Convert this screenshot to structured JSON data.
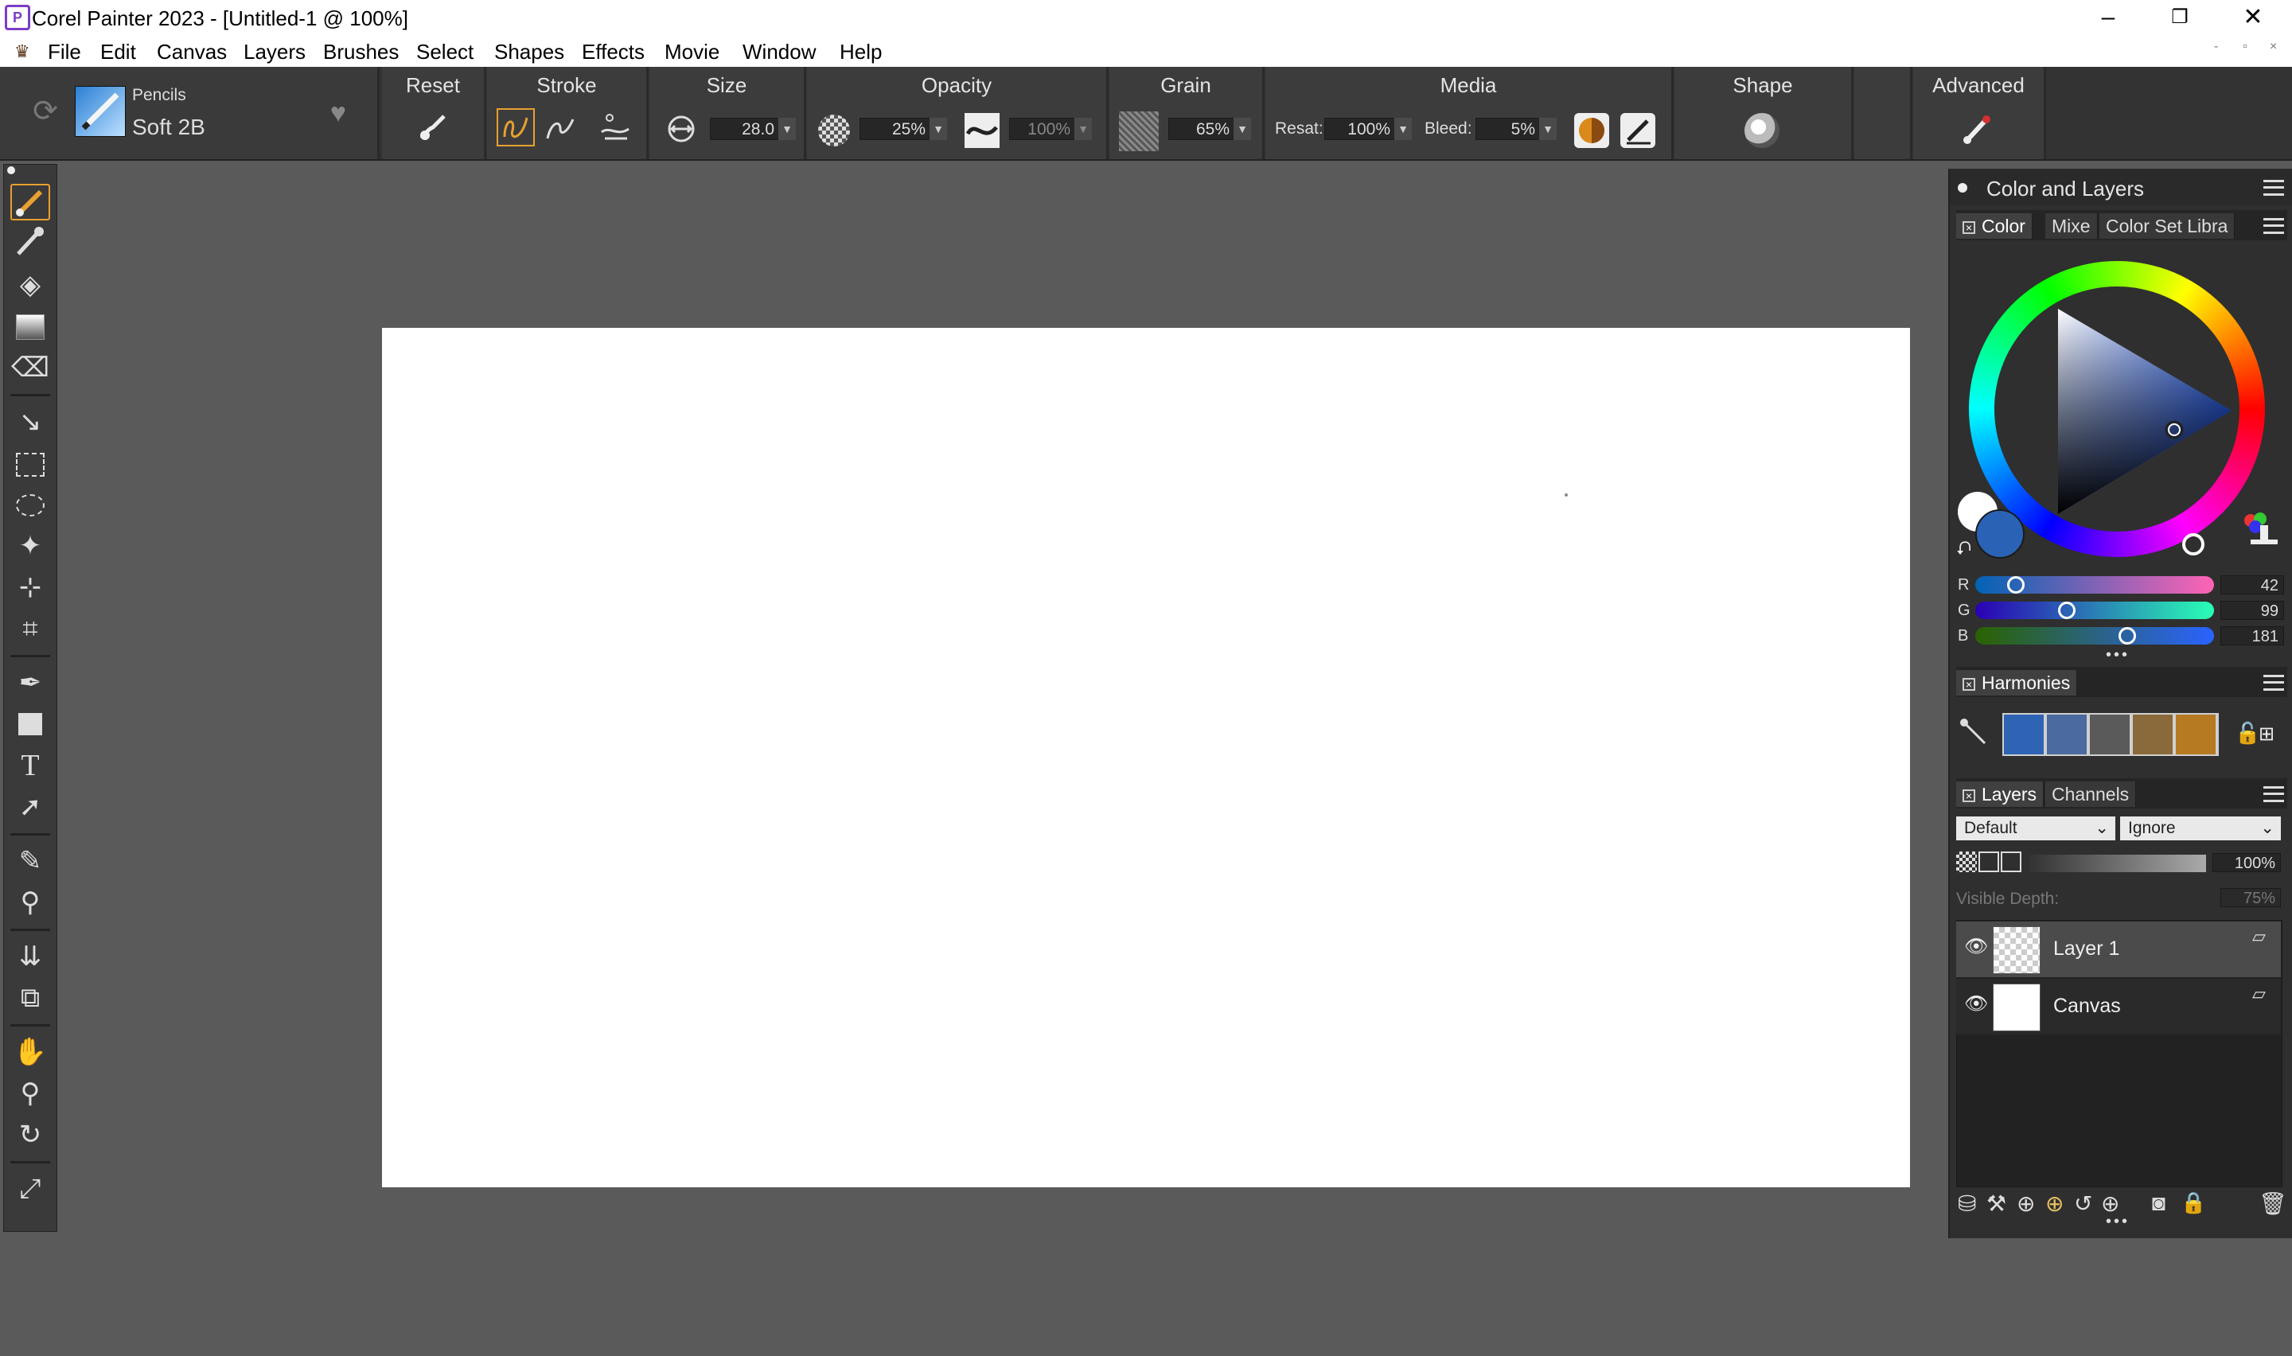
{
  "window": {
    "title": "Corel Painter 2023 - [Untitled-1 @ 100%]",
    "app_icon": "P",
    "controls": {
      "minimize": "–",
      "restore": "❐",
      "close": "✕"
    },
    "mdi_controls": [
      "-",
      "▫",
      "×"
    ]
  },
  "menu": [
    "File",
    "Edit",
    "Canvas",
    "Layers",
    "Brushes",
    "Select",
    "Shapes",
    "Effects",
    "Movie",
    "Window",
    "Help"
  ],
  "brush": {
    "category": "Pencils",
    "variant": "Soft 2B"
  },
  "propbar": {
    "reset": "Reset",
    "stroke": "Stroke",
    "size": {
      "label": "Size",
      "value": "28.0"
    },
    "opacity": {
      "label": "Opacity",
      "value": "25%",
      "second_value": "100%"
    },
    "grain": {
      "label": "Grain",
      "value": "65%"
    },
    "media": {
      "label": "Media",
      "resat_label": "Resat:",
      "resat_value": "100%",
      "bleed_label": "Bleed:",
      "bleed_value": "5%"
    },
    "shape": "Shape",
    "advanced": "Advanced"
  },
  "panel": {
    "title": "Color and Layers",
    "color_tabs": [
      "Color",
      "Mixe",
      "Color Set Libra"
    ],
    "rgb": {
      "r_label": "R",
      "g_label": "G",
      "b_label": "B",
      "r": "42",
      "g": "99",
      "b": "181"
    },
    "harmonies": {
      "title": "Harmonies",
      "swatches": [
        "#2f63b3",
        "#4a6aa0",
        "#5a5a5a",
        "#8a6a3a",
        "#b57a22"
      ]
    },
    "layers": {
      "tabs": [
        "Layers",
        "Channels"
      ],
      "composite_method": "Default",
      "composite_depth": "Ignore",
      "opacity": "100%",
      "visible_depth_label": "Visible Depth:",
      "visible_depth": "75%",
      "items": [
        {
          "name": "Layer 1"
        },
        {
          "name": "Canvas"
        }
      ]
    }
  },
  "colors": {
    "primary": "#2a63b5",
    "secondary": "#ffffff",
    "accent": "#e8a030"
  }
}
